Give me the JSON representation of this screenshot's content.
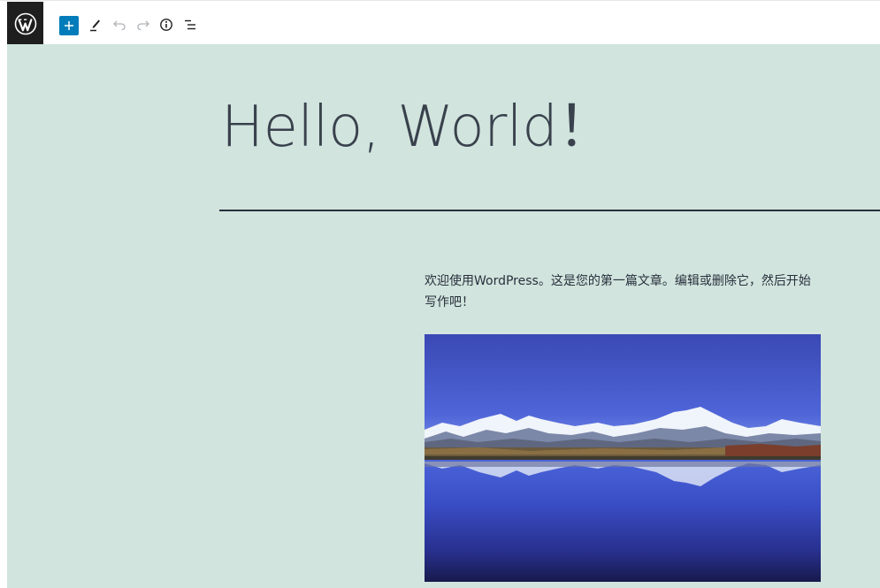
{
  "toolbar": {
    "logo_icon": "wordpress-logo-icon",
    "add_block_icon": "plus-icon",
    "tools_icon": "pencil-icon",
    "undo_icon": "undo-icon",
    "redo_icon": "redo-icon",
    "details_icon": "info-icon",
    "outline_icon": "list-view-icon",
    "colors": {
      "logo_bg": "#1e1e1e",
      "add_bg": "#007cba"
    }
  },
  "post": {
    "title": "Hello, World！",
    "paragraph": "欢迎使用WordPress。这是您的第一篇文章。编辑或删除它，然后开始写作吧！",
    "image_subject": "snow-capped mountains reflected in a lake"
  },
  "theme": {
    "canvas_bg": "#d1e4dd",
    "text_color": "#28303d"
  }
}
